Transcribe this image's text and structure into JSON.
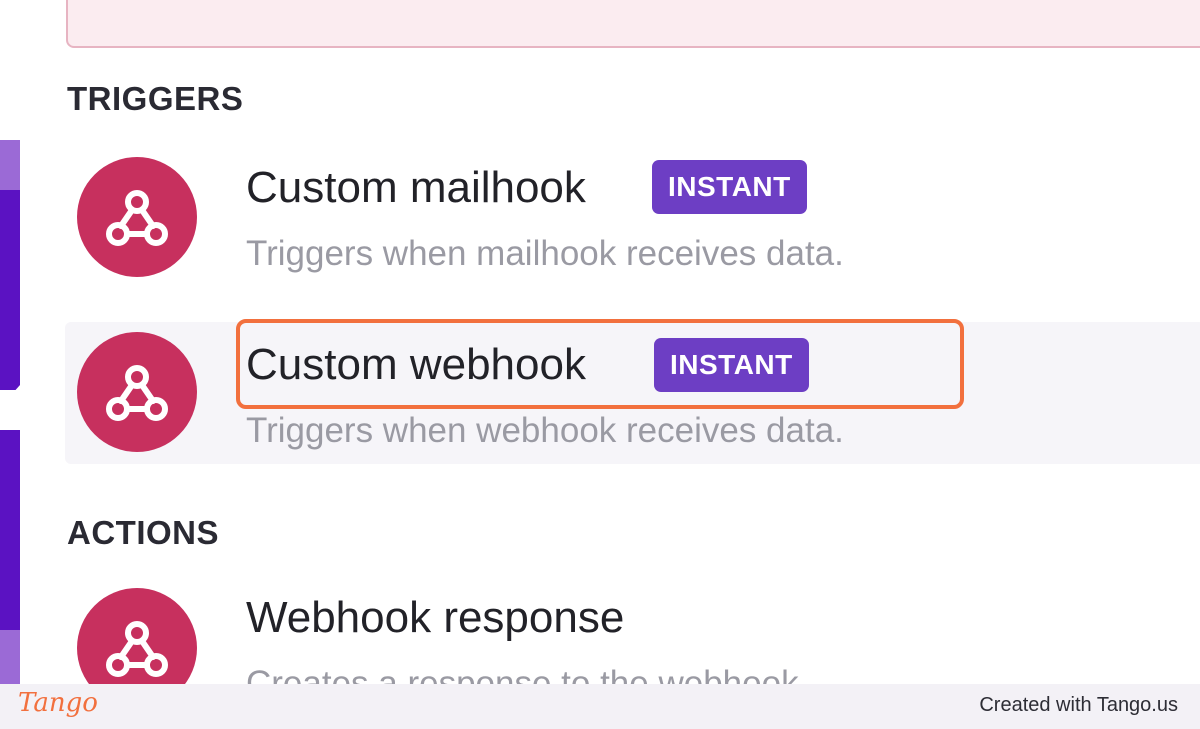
{
  "sections": {
    "triggers_heading": "TRIGGERS",
    "actions_heading": "ACTIONS"
  },
  "triggers": [
    {
      "icon": "webhook-icon",
      "title": "Custom mailhook",
      "badge": "INSTANT",
      "description": "Triggers when mailhook receives data."
    },
    {
      "icon": "webhook-icon",
      "title": "Custom webhook",
      "badge": "INSTANT",
      "description": "Triggers when webhook receives data."
    }
  ],
  "actions": [
    {
      "icon": "webhook-icon",
      "title": "Webhook response",
      "description": "Creates a response to the webhook."
    }
  ],
  "footer": {
    "logo": "Tango",
    "credit": "Created with Tango.us"
  },
  "colors": {
    "icon_bg": "#c7305e",
    "badge_bg": "#6d3ec4",
    "highlight": "#f2703e",
    "sidebar_purple": "#5b12c2"
  }
}
